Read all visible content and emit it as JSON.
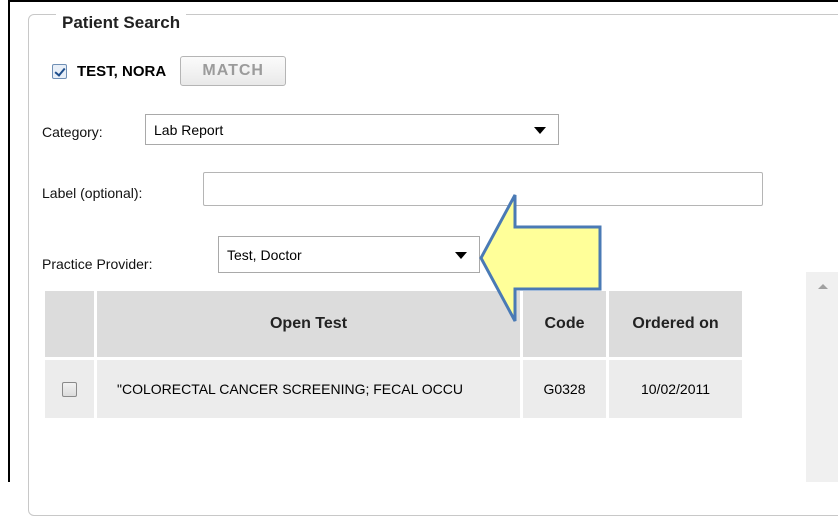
{
  "fieldset": {
    "legend": "Patient Search"
  },
  "patient": {
    "name": "TEST, NORA",
    "checked": true,
    "match_label": "MATCH"
  },
  "category": {
    "label": "Category:",
    "value": "Lab Report"
  },
  "label_field": {
    "label": "Label (optional):",
    "value": ""
  },
  "provider": {
    "label": "Practice Provider:",
    "value": "Test, Doctor"
  },
  "tests_table": {
    "headers": [
      "",
      "Open Test",
      "Code",
      "Ordered on"
    ],
    "rows": [
      {
        "checked": false,
        "test": "\"COLORECTAL CANCER SCREENING; FECAL OCCU",
        "code": "G0328",
        "ordered_on": "10/02/2011"
      }
    ]
  },
  "annotation": {
    "arrow_color": "#ffff99",
    "arrow_border": "#4a7ab5",
    "direction": "left"
  }
}
